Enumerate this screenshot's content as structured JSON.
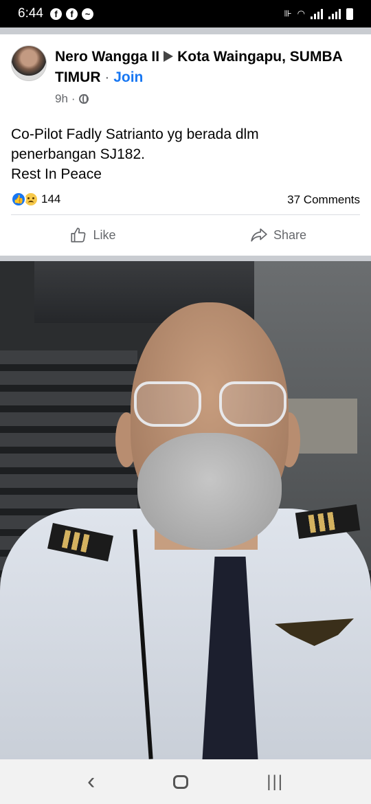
{
  "status_bar": {
    "time": "6:44",
    "notifications": [
      "facebook-icon",
      "facebook-icon",
      "messenger-icon"
    ],
    "right_icons": [
      "vibrate-icon",
      "wifi-icon",
      "signal-icon",
      "signal-icon",
      "battery-icon"
    ]
  },
  "post": {
    "author": "Nero Wangga II",
    "group": "Kota Waingapu, SUMBA TIMUR",
    "separator": "·",
    "join_label": "Join",
    "time": "9h",
    "meta_separator": "·",
    "privacy_icon": "globe-icon",
    "text_line1": "Co-Pilot Fadly Satrianto yg berada dlm",
    "text_line2": "penerbangan SJ182.",
    "text_line3": "Rest In Peace",
    "reaction_count": "144",
    "comments": "37 Comments",
    "like_label": "Like",
    "share_label": "Share"
  },
  "colors": {
    "link_blue": "#1877f2",
    "secondary_text": "#65676b",
    "divider": "#c9ccd1"
  }
}
